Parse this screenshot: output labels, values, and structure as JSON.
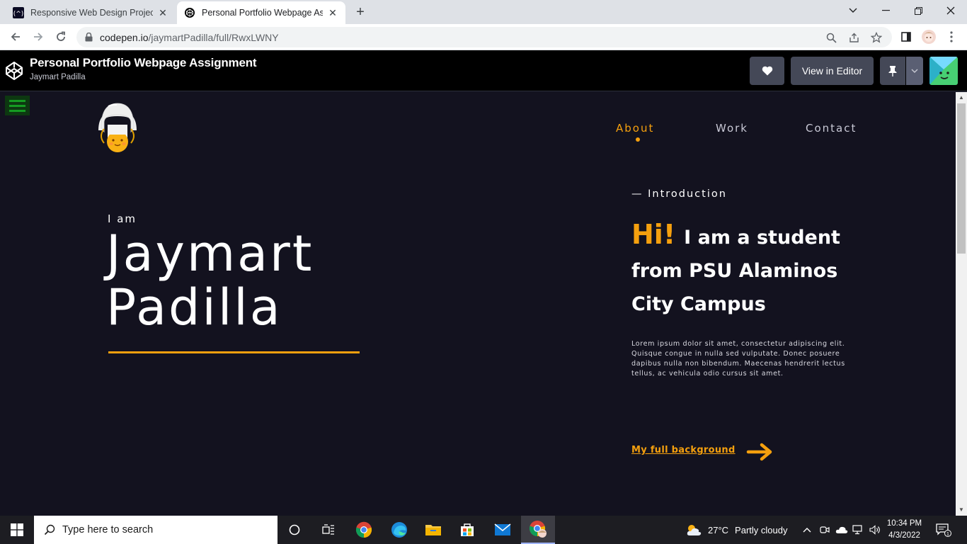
{
  "browser": {
    "tabs": [
      {
        "title": "Responsive Web Design Projects",
        "active": false
      },
      {
        "title": "Personal Portfolio Webpage Assig",
        "active": true
      }
    ],
    "url_host": "codepen.io",
    "url_path": "/jaymartPadilla/full/RwxLWNY"
  },
  "codepen": {
    "title": "Personal Portfolio Webpage Assignment",
    "author": "Jaymart Padilla",
    "view_in_editor": "View in Editor"
  },
  "site": {
    "nav": [
      "About",
      "Work",
      "Contact"
    ],
    "active_nav": "About",
    "greeting": "I am",
    "first_name": "Jaymart",
    "last_name": "Padilla",
    "intro_label": "— Introduction",
    "hi_word": "Hi!",
    "hi_text": "I am a student from PSU Alaminos City Campus",
    "lorem": "Lorem ipsum dolor sit amet, consectetur adipiscing elit. Quisque congue in nulla sed vulputate. Donec posuere dapibus nulla non bibendum. Maecenas hendrerit lectus tellus, ac vehicula odio cursus sit amet.",
    "background_link": "My full background"
  },
  "taskbar": {
    "search_placeholder": "Type here to search",
    "weather_temp": "27°C",
    "weather_desc": "Partly cloudy",
    "time": "10:34 PM",
    "date": "4/3/2022",
    "notification_count": "1"
  },
  "colors": {
    "accent": "#f5a00e",
    "page_bg": "#13121f",
    "header_bg": "#000000"
  }
}
